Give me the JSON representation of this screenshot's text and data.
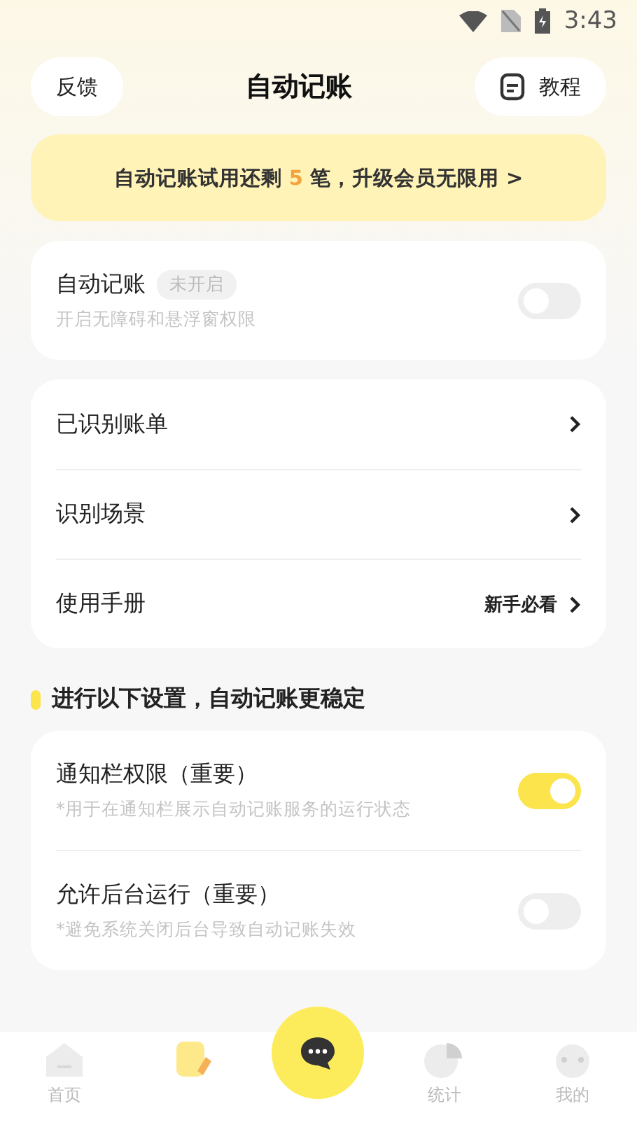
{
  "status_bar": {
    "time": "3:43"
  },
  "header": {
    "left_button": "反馈",
    "title": "自动记账",
    "right_button": "教程"
  },
  "banner": {
    "before": "自动记账试用还剩",
    "count": "5",
    "after": "笔，升级会员无限用 >"
  },
  "auto_card": {
    "title": "自动记账",
    "badge": "未开启",
    "subtitle": "开启无障碍和悬浮窗权限",
    "on": false
  },
  "menu": [
    {
      "label": "已识别账单"
    },
    {
      "label": "识别场景"
    },
    {
      "label": "使用手册",
      "hint": "新手必看"
    }
  ],
  "section_title": "进行以下设置，自动记账更稳定",
  "settings": [
    {
      "title": "通知栏权限（重要）",
      "subtitle": "*用于在通知栏展示自动记账服务的运行状态",
      "on": true
    },
    {
      "title": "允许后台运行（重要）",
      "subtitle": "*避免系统关闭后台导致自动记账失效",
      "on": false
    }
  ],
  "nav": [
    {
      "kind": "home",
      "label": "首页",
      "selected": false
    },
    {
      "kind": "note",
      "selected": true
    },
    {
      "kind": "fab"
    },
    {
      "kind": "stats",
      "label": "统计",
      "selected": false
    },
    {
      "kind": "me",
      "label": "我的",
      "selected": false
    }
  ]
}
